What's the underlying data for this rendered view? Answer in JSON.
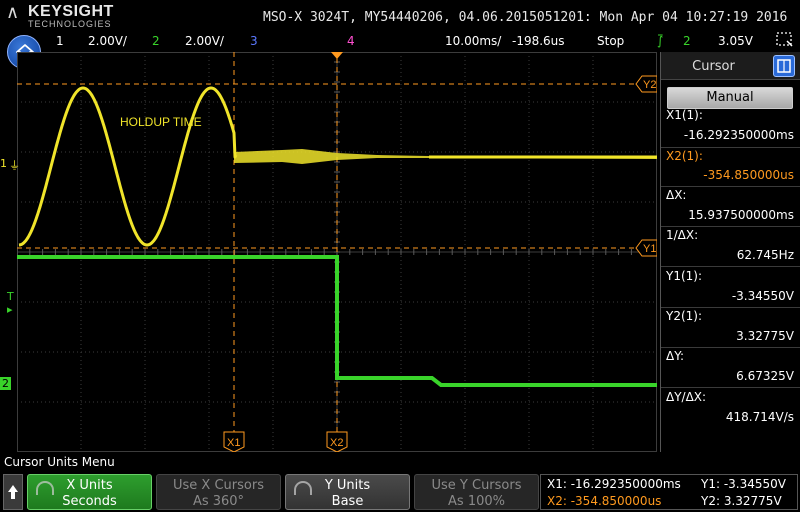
{
  "brand": {
    "name": "KEYSIGHT",
    "sub": "TECHNOLOGIES"
  },
  "scope_title": "MSO-X 3024T, MY54440206, 04.06.2015051201: Mon Apr 04 10:27:19 2016",
  "status": {
    "ch1_num": "1",
    "ch1_scale": "2.00V/",
    "ch2_num": "2",
    "ch2_scale": "2.00V/",
    "ch3_num": "3",
    "ch4_num": "4",
    "timebase": "10.00ms/",
    "delay": "-198.6us",
    "run_state": "Stop",
    "trig_source": "2",
    "trig_level": "3.05V"
  },
  "annotation": "HOLDUP TIME",
  "markers": {
    "y2": "Y2",
    "y1": "Y1",
    "x1": "X1",
    "x2": "X2",
    "ch1": "1",
    "ch2": "2",
    "trigger": "T"
  },
  "panel": {
    "title": "Cursor",
    "mode_button": "Manual",
    "x1_label": "X1(1):",
    "x1_value": "-16.292350000ms",
    "x2_label": "X2(1):",
    "x2_value": "-354.850000us",
    "dx_label": "ΔX:",
    "dx_value": "15.937500000ms",
    "inv_dx_label": "1/ΔX:",
    "inv_dx_value": "62.745Hz",
    "y1_label": "Y1(1):",
    "y1_value": "-3.34550V",
    "y2_label": "Y2(1):",
    "y2_value": "3.32775V",
    "dy_label": "ΔY:",
    "dy_value": "6.67325V",
    "dydx_label": "ΔY/ΔX:",
    "dydx_value": "418.714V/s"
  },
  "menu": {
    "title": "Cursor Units Menu",
    "keys": [
      {
        "line1": "X Units",
        "line2": "Seconds"
      },
      {
        "line1": "Use X Cursors",
        "line2": "As 360°"
      },
      {
        "line1": "Y Units",
        "line2": "Base"
      },
      {
        "line1": "Use Y Cursors",
        "line2": "As 100%"
      }
    ]
  },
  "readout": {
    "x1": "X1: -16.292350000ms",
    "x2": "X2: -354.850000us",
    "y1": "Y1: -3.34550V",
    "y2": "Y2: 3.32775V"
  },
  "colors": {
    "ch1": "#f0e42a",
    "ch2": "#39d42a",
    "cursor": "#ff9a1f",
    "grid": "#3c3c3c"
  }
}
